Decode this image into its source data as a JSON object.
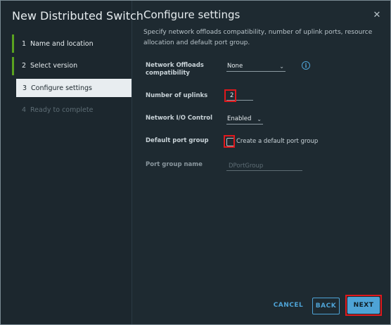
{
  "wizard": {
    "title": "New Distributed Switch",
    "steps": [
      {
        "num": "1",
        "label": "Name and location",
        "state": "done"
      },
      {
        "num": "2",
        "label": "Select version",
        "state": "done"
      },
      {
        "num": "3",
        "label": "Configure settings",
        "state": "active"
      },
      {
        "num": "4",
        "label": "Ready to complete",
        "state": "pending"
      }
    ]
  },
  "page": {
    "title": "Configure settings",
    "subtitle": "Specify network offloads compatibility, number of uplink ports, resource allocation and default port group.",
    "close_icon": "close-icon"
  },
  "form": {
    "offloads_label": "Network Offloads compatibility",
    "offloads_value": "None",
    "uplinks_label": "Number of uplinks",
    "uplinks_value": "2",
    "nioc_label": "Network I/O Control",
    "nioc_value": "Enabled",
    "default_pg_label": "Default port group",
    "default_pg_checkbox_label": "Create a default port group",
    "default_pg_checked": false,
    "pg_name_label": "Port group name",
    "pg_name_placeholder": "DPortGroup"
  },
  "footer": {
    "cancel_label": "CANCEL",
    "back_label": "BACK",
    "next_label": "NEXT"
  },
  "colors": {
    "accent": "#4ea3d6",
    "done_bar": "#5aa220",
    "highlight": "#e0181c",
    "background": "#1e2a31"
  }
}
